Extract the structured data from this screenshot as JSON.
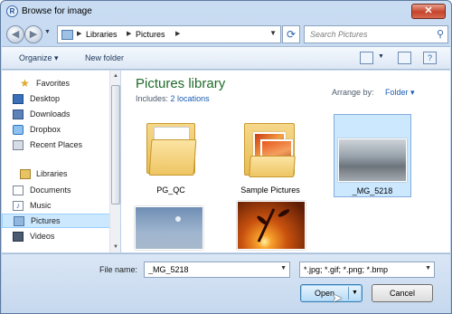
{
  "window": {
    "title": "Browse for image",
    "app_icon": "app-icon",
    "close_label": "✕"
  },
  "nav": {
    "breadcrumbs": [
      "Libraries",
      "Pictures"
    ],
    "search_placeholder": "Search Pictures"
  },
  "toolbar": {
    "organize_label": "Organize ▾",
    "new_folder_label": "New folder"
  },
  "sidebar": {
    "items": [
      {
        "label": "Favorites",
        "icon": "star-icon",
        "header": true
      },
      {
        "label": "Desktop",
        "icon": "desktop-icon"
      },
      {
        "label": "Downloads",
        "icon": "downloads-icon"
      },
      {
        "label": "Dropbox",
        "icon": "dropbox-icon"
      },
      {
        "label": "Recent Places",
        "icon": "recent-places-icon"
      },
      {
        "label": "Libraries",
        "icon": "libraries-icon",
        "header": true
      },
      {
        "label": "Documents",
        "icon": "documents-icon"
      },
      {
        "label": "Music",
        "icon": "music-icon"
      },
      {
        "label": "Pictures",
        "icon": "pictures-icon",
        "selected": true
      },
      {
        "label": "Videos",
        "icon": "videos-icon"
      }
    ]
  },
  "library": {
    "title": "Pictures library",
    "includes_label": "Includes:",
    "includes_link": "2 locations",
    "arrange_label": "Arrange by:",
    "arrange_value": "Folder ▾"
  },
  "files": [
    {
      "label": "PG_QC",
      "type": "folder"
    },
    {
      "label": "Sample Pictures",
      "type": "folder"
    },
    {
      "label": "_MG_5218",
      "type": "image",
      "selected": true
    },
    {
      "label": "",
      "type": "image"
    },
    {
      "label": "",
      "type": "image"
    }
  ],
  "footer": {
    "file_name_label": "File name:",
    "file_name_value": "_MG_5218",
    "file_type_value": "*.jpg; *.gif; *.png; *.bmp",
    "open_label": "Open",
    "cancel_label": "Cancel"
  },
  "colors": {
    "library_title": "#1e6b2a",
    "link": "#1a5cb4",
    "selection": "#cce8ff"
  }
}
